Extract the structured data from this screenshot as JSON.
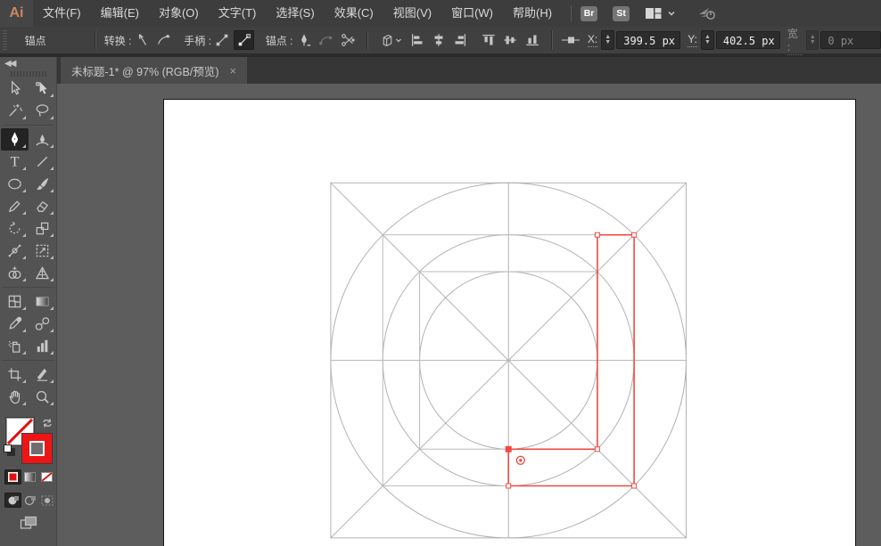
{
  "app": {
    "logo_text": "Ai"
  },
  "menubar": {
    "items": [
      "文件(F)",
      "编辑(E)",
      "对象(O)",
      "文字(T)",
      "选择(S)",
      "效果(C)",
      "视图(V)",
      "窗口(W)",
      "帮助(H)"
    ],
    "bridge_badge": "Br",
    "stock_badge": "St"
  },
  "controlbar": {
    "panel_label": "锚点",
    "convert_label": "转换 :",
    "handles_label": "手柄 :",
    "anchors_label": "锚点 :",
    "x_label": "X:",
    "x_value": "399.5 px",
    "y_label": "Y:",
    "y_value": "402.5 px",
    "width_label": "宽 :",
    "width_value": "0 px"
  },
  "tabbar": {
    "title": "未标题-1* @ 97% (RGB/预览)",
    "close_glyph": "×"
  },
  "tools": {
    "list": [
      "selection",
      "direct-selection",
      "magic-wand",
      "lasso",
      "pen",
      "curvature",
      "type",
      "line-segment",
      "ellipse",
      "paintbrush",
      "pencil",
      "eraser",
      "rotate",
      "scale",
      "width-tool",
      "free-transform",
      "shape-builder",
      "perspective-grid",
      "mesh",
      "gradient",
      "eyedropper",
      "blend",
      "symbol-sprayer",
      "column-graph",
      "artboard-tool",
      "slice",
      "hand",
      "zoom"
    ],
    "selected": "pen",
    "separators_after": [
      3,
      17,
      23
    ]
  },
  "swatches": {
    "fill": "none",
    "stroke_color": "#ed1515",
    "modes": [
      "draw-normal",
      "draw-behind",
      "draw-inside"
    ],
    "active_mode": "draw-normal"
  },
  "artwork": {
    "grid_color": "#b2b2b2",
    "accent": "#ef4a44",
    "center": [
      386.2,
      292.6
    ],
    "half": 199.3,
    "red_path": [
      [
        386.2,
        392.3
      ],
      [
        485.9,
        392.3
      ],
      [
        485.9,
        151.7
      ],
      [
        527.1,
        151.7
      ],
      [
        527.1,
        433.5
      ],
      [
        386.2,
        433.5
      ]
    ],
    "filled_anchor_index": 0,
    "cursor_indicator": [
      399.8,
      404.8
    ]
  }
}
